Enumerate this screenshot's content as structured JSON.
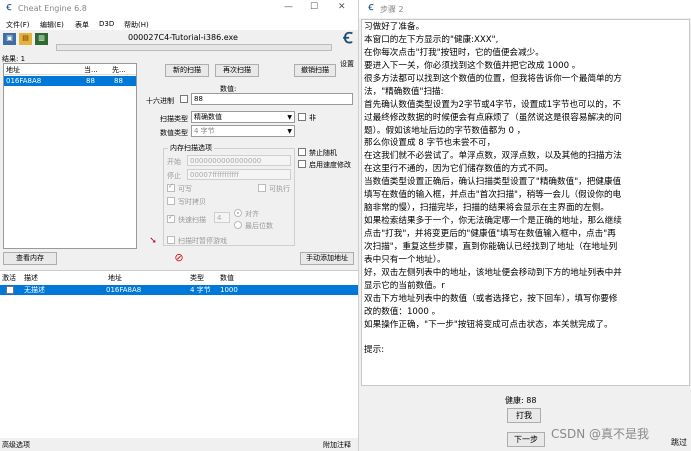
{
  "ce": {
    "title": "Cheat Engine 6.8",
    "process": "000027C4-Tutorial-i386.exe",
    "menu": [
      "文件(F)",
      "编辑(E)",
      "表单",
      "D3D",
      "帮助(H)"
    ],
    "results_label": "结果: 1",
    "columns": [
      "地址",
      "当...",
      "先..."
    ],
    "result_row": [
      "016FA8A8",
      "88",
      "88"
    ],
    "buttons": {
      "new_scan": "新的扫描",
      "next_scan": "再次扫描",
      "undo_scan": "撤销扫描",
      "view_memory": "查看内存",
      "add_manual": "手动添加地址"
    },
    "settings_label": "设置",
    "value_label": "数值:",
    "hex_label": "十六进制",
    "value": "88",
    "scan_type_label": "扫描类型",
    "scan_type": "精确数值",
    "value_type_label": "数值类型",
    "value_type": "4 字节",
    "not_label": "非",
    "mem_group": "内存扫描选项",
    "start_label": "开始",
    "start_value": "0000000000000000",
    "stop_label": "停止",
    "stop_value": "00007fffffffffff",
    "writable": "可写",
    "executable": "可执行",
    "copy_on_write": "写时拷贝",
    "fast_scan": "快速扫描",
    "fast_value": "4",
    "align": "对齐",
    "last_digits": "最后位数",
    "pause_game": "扫描时暂停游戏",
    "disable_random": "禁止随机",
    "enable_speedhack": "启用速度修改",
    "table_columns": [
      "激活",
      "描述",
      "地址",
      "类型",
      "数值"
    ],
    "table_row": {
      "desc": "无描述",
      "addr": "016FA8A8",
      "type": "4 字节",
      "value": "1000"
    },
    "advanced": "高级选项",
    "comment": "附加注释"
  },
  "tut": {
    "title": "步骤 2",
    "lines": [
      "习做好了准备。",
      "本窗口的左下方显示的\"健康:XXX\",",
      "在你每次点击\"打我\"按钮时，它的值便会减少。",
      "要进入下一关，你必须找到这个数值并把它改成 1000 。",
      "很多方法都可以找到这个数值的位置，但我将告诉你一个最简单的方",
      "法，\"精确数值\"扫描:",
      "首先确认数值类型设置为2字节或4字节，设置成1字节也可以的，不",
      "过最终修改数据的时候便会有点麻烦了（虽然说这是很容易解决的问",
      "题）。假如该地址后边的字节数值都为 0 ，",
      "那么你设置成 8 字节也未尝不可，",
      "在这我们就不必尝试了。单浮点数，双浮点数，以及其他的扫描方法",
      "在这里行不通的，因为它们储存数值的方式不同。",
      "当数值类型设置正确后，确认扫描类型设置了\"精确数值\"，把健康值",
      "填写在数值的输入框，并点击\"首次扫描\"，稍等一会儿（假设你的电",
      "脑非常的慢），扫描完毕，扫描的结果将会显示在主界面的左侧。",
      "如果检索结果多于一个，你无法确定哪一个是正确的地址，那么继续",
      "点击\"打我\"，并将变更后的\"健康值\"填写在数值输入框中，点击\"再",
      "次扫描\"，重复这些步骤，直到你能确认已经找到了地址（在地址列",
      "表中只有一个地址）。",
      "好，双击左侧列表中的地址，该地址便会移动到下方的地址列表中并",
      "显示它的当前数值。r",
      "双击下方地址列表中的数值（或者选择它，按下回车），填写你要修",
      "改的数值：1000 。",
      "如果操作正确，\"下一步\"按钮将变成可点击状态，本关就完成了。",
      "",
      "提示:"
    ],
    "health": "健康: 88",
    "hit": "打我",
    "next": "下一步",
    "skip": "跳过",
    "watermark": "CSDN @真不是我"
  }
}
